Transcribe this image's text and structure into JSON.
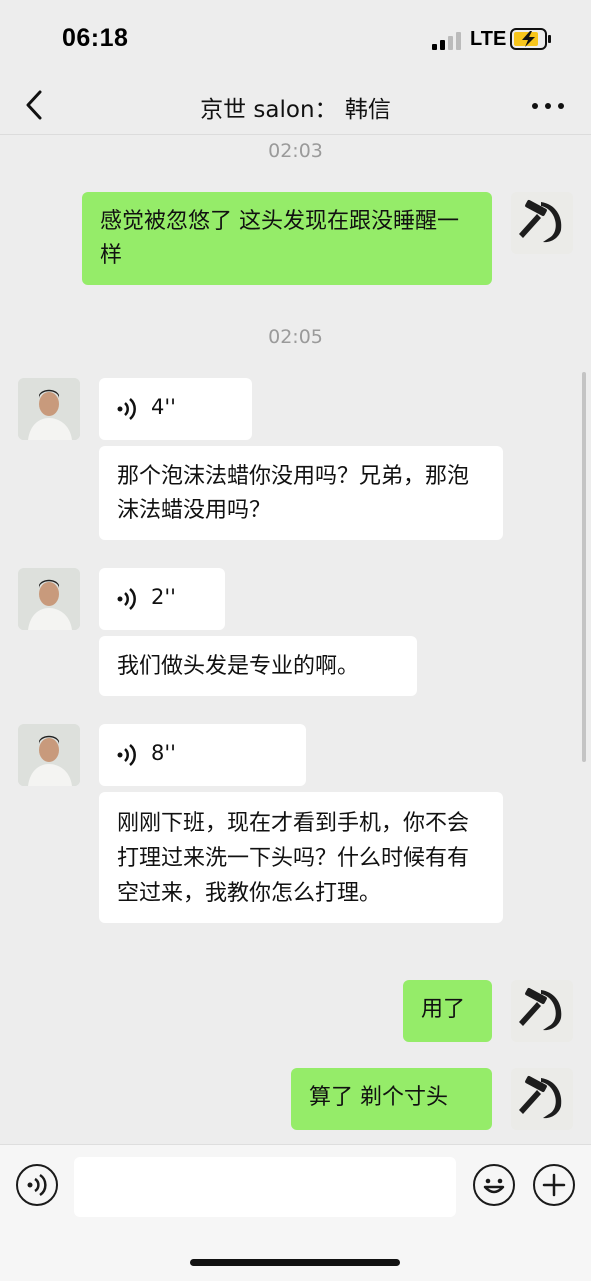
{
  "status_bar": {
    "time": "06:18",
    "network": "LTE",
    "icons": [
      "signal-icon",
      "battery-charging-icon"
    ]
  },
  "nav": {
    "title": "京世 salon： 韩信",
    "icons": [
      "back-chevron-icon",
      "more-dots-icon"
    ]
  },
  "messages": [
    {
      "type": "timestamp",
      "text": "02:03"
    },
    {
      "type": "text",
      "from": "me",
      "text": "感觉被忽悠了 这头发现在跟没睡醒一样"
    },
    {
      "type": "timestamp",
      "text": "02:05"
    },
    {
      "type": "voice",
      "from": "other",
      "duration": "4''"
    },
    {
      "type": "text",
      "from": "other",
      "text": "那个泡沫法蜡你没用吗？兄弟，那泡沫法蜡没用吗？"
    },
    {
      "type": "voice",
      "from": "other",
      "duration": "2''"
    },
    {
      "type": "text",
      "from": "other",
      "text": "我们做头发是专业的啊。"
    },
    {
      "type": "voice",
      "from": "other",
      "duration": "8''"
    },
    {
      "type": "text",
      "from": "other",
      "text": "刚刚下班，现在才看到手机，你不会打理过来洗一下头吗？什么时候有有空过来，我教你怎么打理。"
    },
    {
      "type": "text",
      "from": "me",
      "text": "用了"
    },
    {
      "type": "text",
      "from": "me",
      "text": "算了 剃个寸头"
    }
  ],
  "input_bar": {
    "value": "",
    "icons": [
      "voice-mode-icon",
      "emoji-icon",
      "plus-icon"
    ]
  },
  "colors": {
    "background": "#ededed",
    "my_bubble": "#95ec69",
    "other_bubble": "#ffffff",
    "timestamp": "#9a9a9a"
  }
}
